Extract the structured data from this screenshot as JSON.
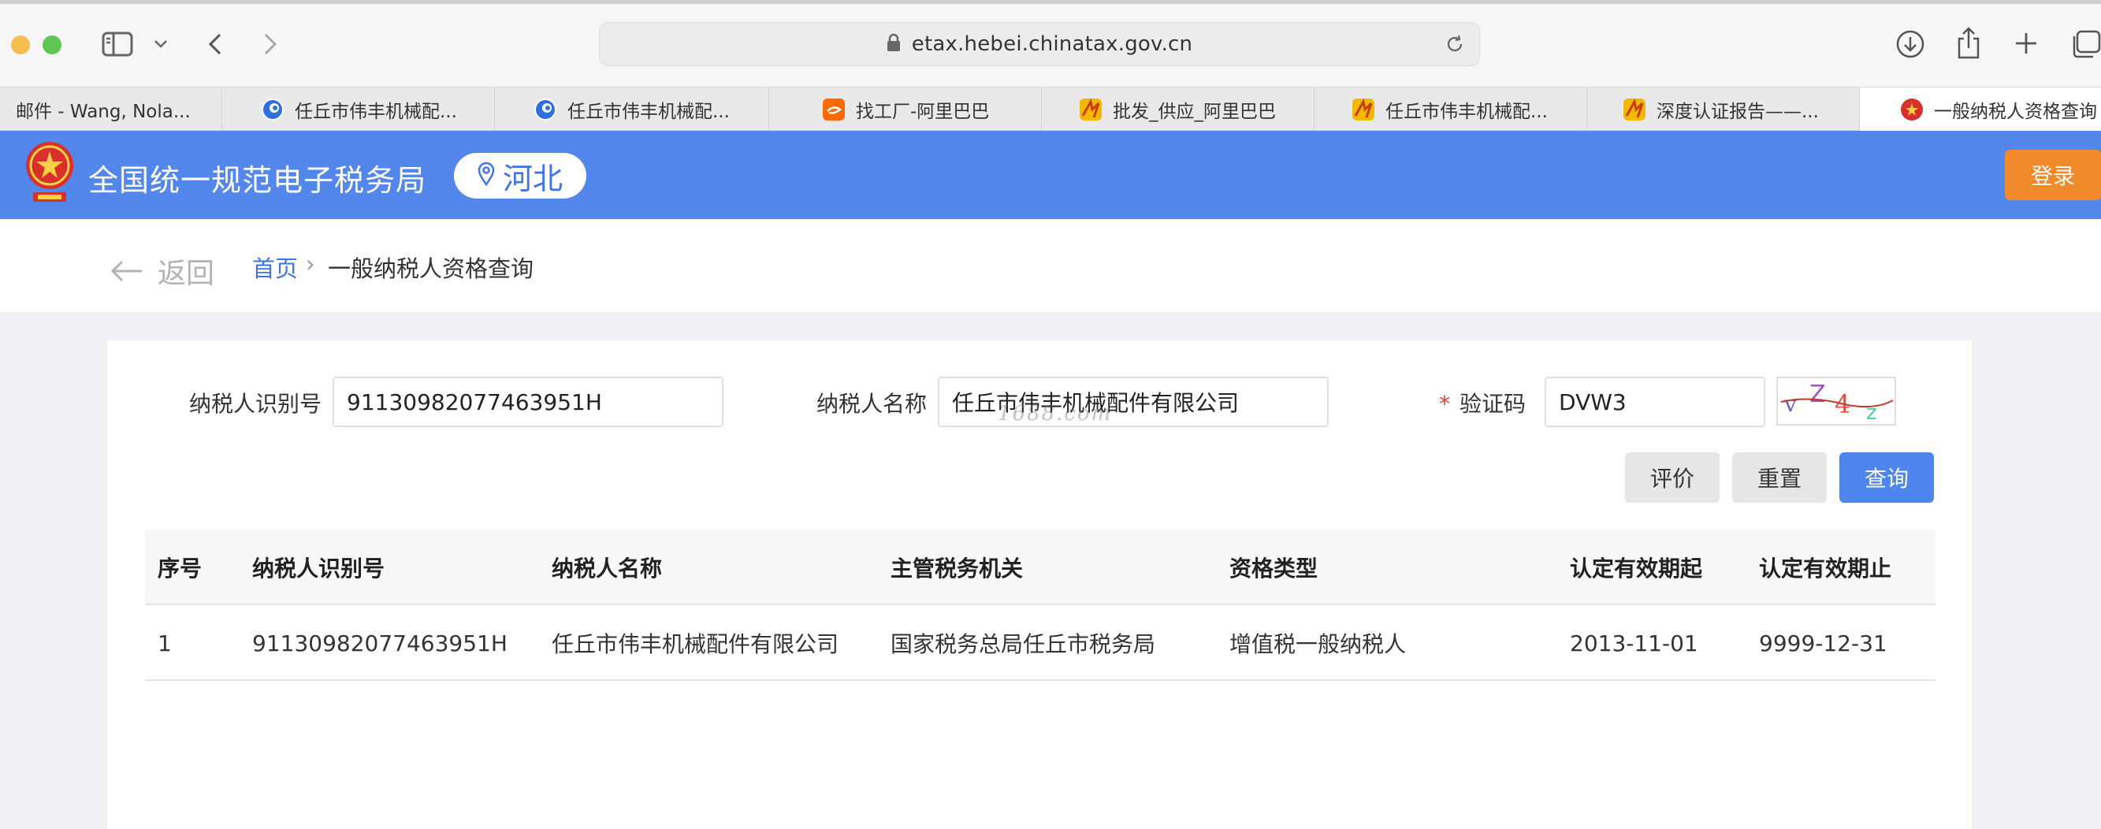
{
  "browser": {
    "url": "etax.hebei.chinatax.gov.cn",
    "tabs": [
      {
        "title": "邮件 - Wang, Nola..."
      },
      {
        "title": "任丘市伟丰机械配..."
      },
      {
        "title": "任丘市伟丰机械配..."
      },
      {
        "title": "找工厂-阿里巴巴"
      },
      {
        "title": "批发_供应_阿里巴巴"
      },
      {
        "title": "任丘市伟丰机械配..."
      },
      {
        "title": "深度认证报告——..."
      },
      {
        "title": "一般纳税人资格查询"
      }
    ]
  },
  "header": {
    "site_title": "全国统一规范电子税务局",
    "region": "河北",
    "login_label": "登录",
    "brand_color": "#5487ec"
  },
  "breadcrumb": {
    "back_label": "返回",
    "home": "首页",
    "separator": "›",
    "current": "一般纳税人资格查询"
  },
  "form": {
    "taxpayer_id_label": "纳税人识别号",
    "taxpayer_id_value": "91130982077463951H",
    "taxpayer_name_label": "纳税人名称",
    "taxpayer_name_value": "任丘市伟丰机械配件有限公司",
    "captcha_required_mark": "*",
    "captcha_label": "验证码",
    "captcha_value": "DVW3",
    "watermark": "1688.com",
    "buttons": {
      "evaluate": "评价",
      "reset": "重置",
      "query": "查询"
    }
  },
  "table": {
    "headers": [
      "序号",
      "纳税人识别号",
      "纳税人名称",
      "主管税务机关",
      "资格类型",
      "认定有效期起",
      "认定有效期止"
    ],
    "rows": [
      [
        "1",
        "91130982077463951H",
        "任丘市伟丰机械配件有限公司",
        "国家税务总局任丘市税务局",
        "增值税一般纳税人",
        "2013-11-01",
        "9999-12-31"
      ]
    ]
  }
}
